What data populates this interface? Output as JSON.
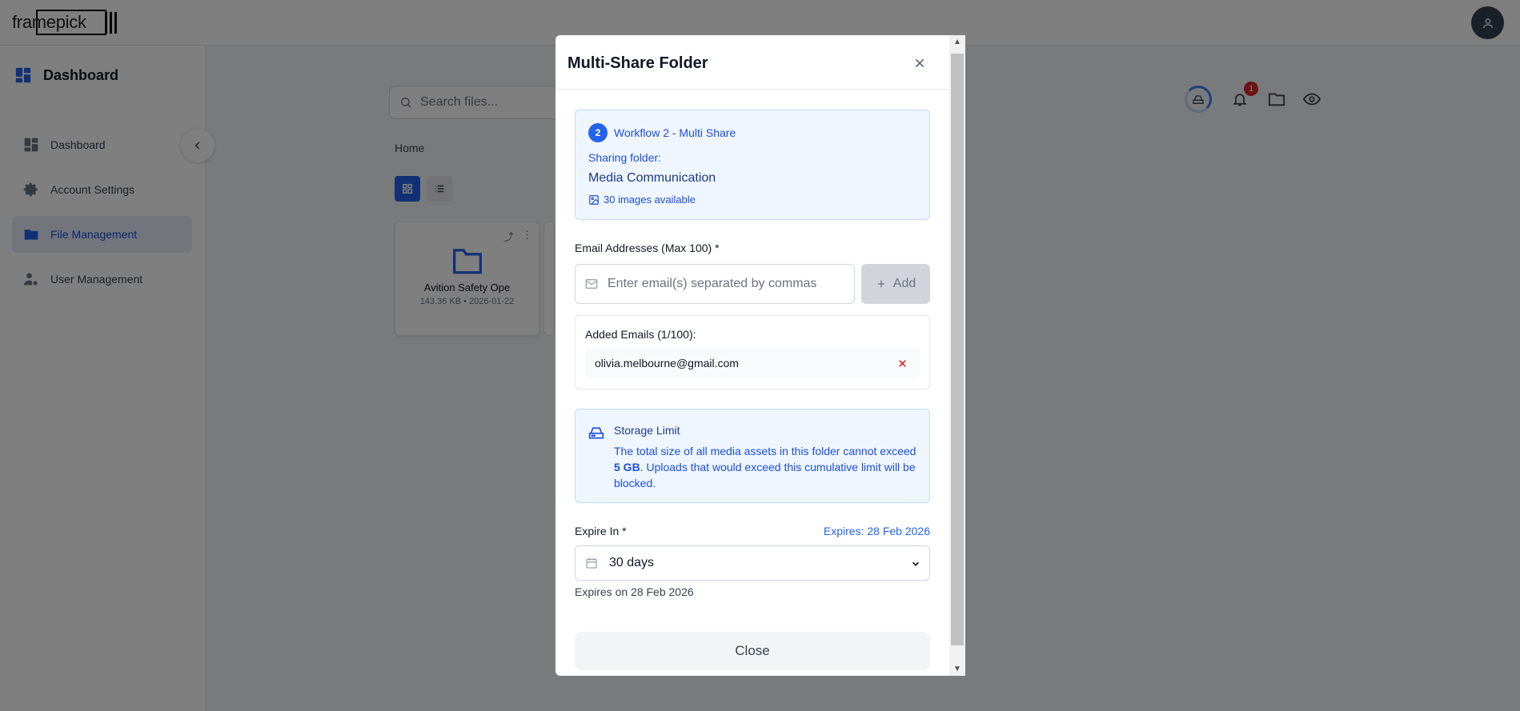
{
  "app": {
    "logo": "framepick",
    "avatar_icon": "user-icon"
  },
  "sidebar": {
    "header_title": "Dashboard",
    "items": [
      {
        "label": "Dashboard",
        "icon": "dashboard-icon"
      },
      {
        "label": "Account Settings",
        "icon": "gear-icon"
      },
      {
        "label": "File Management",
        "icon": "folder-icon"
      },
      {
        "label": "User Management",
        "icon": "user-cog-icon"
      }
    ]
  },
  "main": {
    "search_placeholder": "Search files...",
    "notification_count": "1",
    "breadcrumb": "Home",
    "folder_card": {
      "name": "Avition Safety Ope",
      "meta": "143.36 KB • 2026-01-22"
    }
  },
  "modal": {
    "title": "Multi-Share Folder",
    "workflow": {
      "step": "2",
      "label": "Workflow 2 - Multi Share",
      "sharing_label": "Sharing folder:",
      "folder_name": "Media Communication",
      "images_available": "30 images available"
    },
    "email": {
      "label": "Email Addresses (Max 100) *",
      "placeholder": "Enter email(s) separated by commas",
      "value": "",
      "add_label": "Add"
    },
    "added": {
      "label": "Added Emails (1/100):",
      "emails": [
        "olivia.melbourne@gmail.com"
      ]
    },
    "storage": {
      "title": "Storage Limit",
      "text_before": "The total size of all media assets in this folder cannot exceed ",
      "limit": "5 GB",
      "text_after": ". Uploads that would exceed this cumulative limit will be blocked."
    },
    "expire": {
      "label": "Expire In *",
      "expires_header": "Expires: 28 Feb 2026",
      "selected": "30 days",
      "note": "Expires on 28 Feb 2026"
    },
    "close_label": "Close"
  },
  "colors": {
    "accent": "#2563eb",
    "info_bg": "#eff6ff",
    "danger": "#dc2626"
  }
}
